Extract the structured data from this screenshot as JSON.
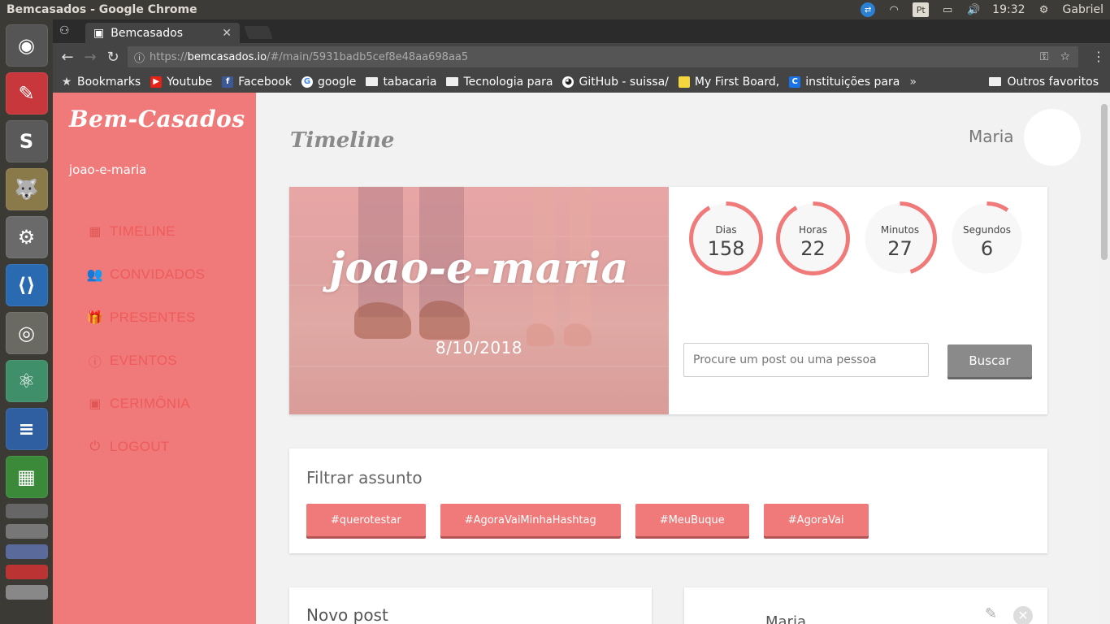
{
  "os": {
    "window_title": "Bemcasados - Google Chrome",
    "clock": "19:32",
    "user": "Gabriel",
    "keyboard_layout": "Pt"
  },
  "browser": {
    "tab_title": "Bemcasados",
    "url_protocol": "https://",
    "url_host": "bemcasados.io",
    "url_path": "/#/main/5931badb5cef8e48aa698aa5",
    "bookmarks": [
      {
        "label": "Bookmarks",
        "icon": "star-icon"
      },
      {
        "label": "Youtube",
        "icon": "youtube-icon"
      },
      {
        "label": "Facebook",
        "icon": "facebook-icon"
      },
      {
        "label": "google",
        "icon": "google-icon"
      },
      {
        "label": "tabacaria",
        "icon": "folder-icon"
      },
      {
        "label": "Tecnologia para",
        "icon": "folder-icon"
      },
      {
        "label": "GitHub - suissa/",
        "icon": "github-icon"
      },
      {
        "label": "My First Board, ",
        "icon": "note-icon"
      },
      {
        "label": "instituições para",
        "icon": "c-icon"
      }
    ],
    "bookmarks_more": "»",
    "other_bookmarks": "Outros favoritos"
  },
  "app": {
    "brand": "Bem-Casados",
    "couple_slug": "joao-e-maria",
    "nav": [
      {
        "label": "TIMELINE",
        "icon": "dashboard-icon"
      },
      {
        "label": "CONVIDADOS",
        "icon": "people-icon"
      },
      {
        "label": "PRESENTES",
        "icon": "gift-icon"
      },
      {
        "label": "EVENTOS",
        "icon": "info-icon"
      },
      {
        "label": "CERIMÔNIA",
        "icon": "calendar-icon"
      },
      {
        "label": "LOGOUT",
        "icon": "power-icon"
      }
    ],
    "page_title": "Timeline",
    "user_name": "Maria",
    "hero": {
      "name": "joao-e-maria",
      "date": "8/10/2018"
    },
    "countdown": [
      {
        "label": "Dias",
        "value": "158",
        "fraction": 0.92
      },
      {
        "label": "Horas",
        "value": "22",
        "fraction": 0.92
      },
      {
        "label": "Minutos",
        "value": "27",
        "fraction": 0.45
      },
      {
        "label": "Segundos",
        "value": "6",
        "fraction": 0.1
      }
    ],
    "search": {
      "placeholder": "Procure um post ou uma pessoa",
      "button": "Buscar"
    },
    "filter": {
      "title": "Filtrar assunto",
      "tags": [
        "#querotestar",
        "#AgoraVaiMinhaHashtag",
        "#MeuBuque",
        "#AgoraVai"
      ]
    },
    "new_post_title": "Novo post",
    "feed_user": "Maria"
  },
  "colors": {
    "accent": "#f07a7a",
    "nav_text": "#ef5a5a",
    "button_gray": "#8a8a8a"
  }
}
